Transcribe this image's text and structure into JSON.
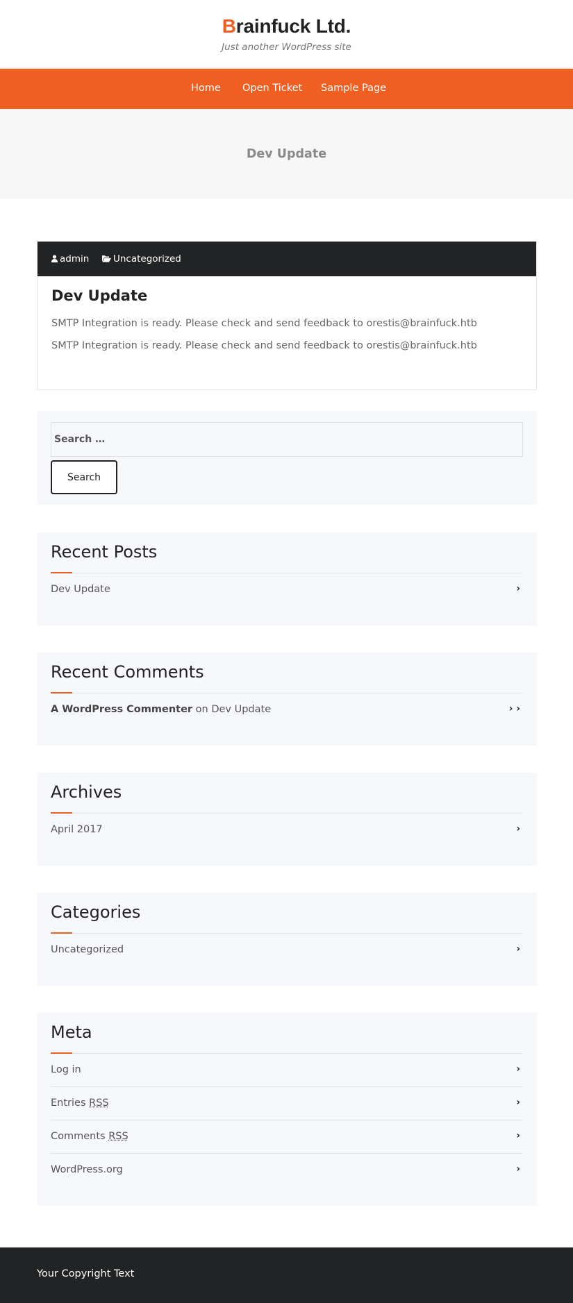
{
  "header": {
    "title_first": "B",
    "title_rest": "rainfuck Ltd.",
    "tagline": "Just another WordPress site"
  },
  "nav": {
    "items": [
      "Home",
      "Open Ticket",
      "Sample Page"
    ]
  },
  "banner": {
    "title": "Dev Update"
  },
  "post": {
    "author": "admin",
    "category": "Uncategorized",
    "title": "Dev Update",
    "lines": [
      "SMTP Integration is ready. Please check and send feedback to orestis@brainfuck.htb",
      "SMTP Integration is ready. Please check and send feedback to orestis@brainfuck.htb"
    ]
  },
  "search": {
    "placeholder": "Search …",
    "button_label": "Search"
  },
  "recent_posts": {
    "title": "Recent Posts",
    "items": [
      "Dev Update"
    ]
  },
  "recent_comments": {
    "title": "Recent Comments",
    "items": [
      {
        "author": "A WordPress Commenter",
        "on": "on",
        "post": "Dev Update"
      }
    ]
  },
  "archives": {
    "title": "Archives",
    "items": [
      "April 2017"
    ]
  },
  "categories": {
    "title": "Categories",
    "items": [
      "Uncategorized"
    ]
  },
  "meta": {
    "title": "Meta",
    "items": [
      {
        "text": "Log in",
        "abbr": ""
      },
      {
        "text": "Entries",
        "abbr": "RSS"
      },
      {
        "text": "Comments",
        "abbr": "RSS"
      },
      {
        "text": "WordPress.org",
        "abbr": ""
      }
    ]
  },
  "footer": {
    "copyright": "Your Copyright Text"
  },
  "colors": {
    "accent": "#f05f22",
    "dark": "#222324",
    "widget_bg": "#f7f8fb"
  },
  "icons": {
    "author": "user-icon",
    "category": "folder-open-icon",
    "list_arrow": "chevron-right-icon"
  }
}
